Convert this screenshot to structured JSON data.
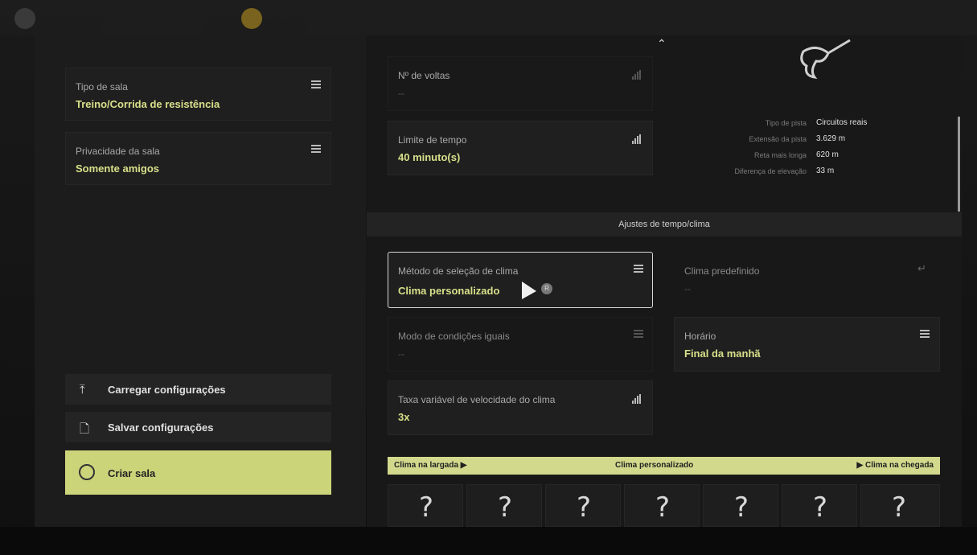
{
  "left_panel": {
    "room_type": {
      "label": "Tipo de sala",
      "value": "Treino/Corrida de resistência"
    },
    "room_privacy": {
      "label": "Privacidade da sala",
      "value": "Somente amigos"
    },
    "load_button": "Carregar configurações",
    "save_button": "Salvar configurações",
    "create_button": "Criar sala"
  },
  "race": {
    "laps": {
      "label": "Nº de voltas",
      "value": "--"
    },
    "time_limit": {
      "label": "Limite de tempo",
      "value": "40 minuto(s)"
    }
  },
  "track_info": [
    {
      "label": "Tipo de pista",
      "value": "Circuitos reais"
    },
    {
      "label": "Extensão da pista",
      "value": "3.629 m"
    },
    {
      "label": "Reta mais longa",
      "value": "620 m"
    },
    {
      "label": "Diferença de elevação",
      "value": "33 m"
    }
  ],
  "weather_section_title": "Ajustes de tempo/clima",
  "weather": {
    "selection_method": {
      "label": "Método de seleção de clima",
      "value": "Clima personalizado"
    },
    "preset": {
      "label": "Clima predefinido",
      "value": "--"
    },
    "equal_conditions": {
      "label": "Modo de condições iguais",
      "value": "--"
    },
    "time_of_day": {
      "label": "Horário",
      "value": "Final da manhã"
    },
    "speed_rate": {
      "label": "Taxa variável de velocidade do clima",
      "value": "3x"
    }
  },
  "timeline": {
    "start": "Clima na largada ▶",
    "center": "Clima personalizado",
    "end": "▶ Clima na chegada",
    "slots": [
      "?",
      "?",
      "?",
      "?",
      "?",
      "?",
      "?"
    ]
  },
  "cursor_badge": "R",
  "icons": {
    "upload": "upload-icon",
    "save": "save-file-icon",
    "globe": "globe-add-icon",
    "menu": "list-menu-icon",
    "signal": "signal-bars-icon",
    "enter": "enter-icon",
    "collapse": "chevron-up-icon"
  },
  "colors": {
    "accent": "#d8e08a",
    "button_highlight": "#ccd47a"
  }
}
